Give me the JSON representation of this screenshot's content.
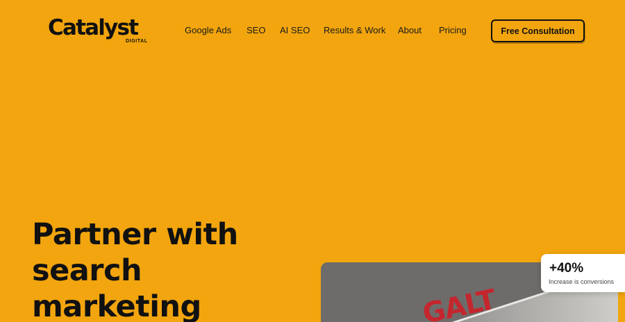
{
  "header": {
    "logo": {
      "main": "Catalyst",
      "sub": "DIGITAL"
    },
    "nav": [
      {
        "label": "Google Ads"
      },
      {
        "label": "SEO"
      },
      {
        "label": "AI SEO"
      },
      {
        "label": "Results & Work"
      },
      {
        "label": "About"
      },
      {
        "label": "Pricing"
      }
    ],
    "cta_label": "Free Consultation"
  },
  "hero": {
    "title_lines": [
      "Partner with",
      "search",
      "marketing"
    ],
    "image_sign_text": "GALT",
    "stat": {
      "value": "+40%",
      "label": "Increase is conversions"
    }
  },
  "colors": {
    "background": "#f2a50e",
    "text": "#111111",
    "card": "#ffffff",
    "sign_red": "#c4262e"
  }
}
